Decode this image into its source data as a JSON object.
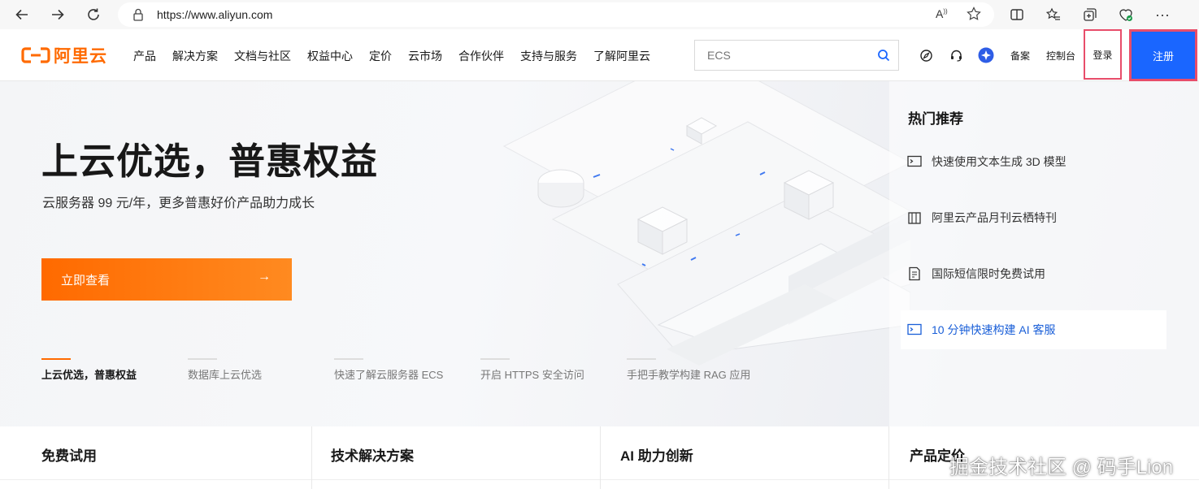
{
  "browser": {
    "url": "https://www.aliyun.com"
  },
  "header": {
    "logo_text": "阿里云",
    "nav": [
      "产品",
      "解决方案",
      "文档与社区",
      "权益中心",
      "定价",
      "云市场",
      "合作伙伴",
      "支持与服务",
      "了解阿里云"
    ],
    "search_placeholder": "ECS",
    "beian": "备案",
    "console": "控制台",
    "login": "登录",
    "register": "注册"
  },
  "hero": {
    "title": "上云优选，普惠权益",
    "subtitle": "云服务器 99 元/年，更多普惠好价产品助力成长",
    "cta": "立即查看",
    "tabs": [
      {
        "label": "上云优选，普惠权益",
        "active": true
      },
      {
        "label": "数据库上云优选",
        "active": false
      },
      {
        "label": "快速了解云服务器 ECS",
        "active": false
      },
      {
        "label": "开启 HTTPS 安全访问",
        "active": false
      },
      {
        "label": "手把手教学构建 RAG 应用",
        "active": false
      }
    ]
  },
  "hot": {
    "title": "热门推荐",
    "items": [
      {
        "label": "快速使用文本生成 3D 模型",
        "icon": "terminal-icon"
      },
      {
        "label": "阿里云产品月刊云栖特刊",
        "icon": "book-icon"
      },
      {
        "label": "国际短信限时免费试用",
        "icon": "document-icon"
      },
      {
        "label": "10 分钟快速构建 AI 客服",
        "icon": "terminal-icon"
      }
    ]
  },
  "cards": [
    "免费试用",
    "技术解决方案",
    "AI 助力创新",
    "产品定价"
  ],
  "watermark": "掘金技术社区 @ 码手Lion",
  "colors": {
    "brand": "#ff6a00",
    "primary": "#1a66ff",
    "highlight": "#e84d6a"
  }
}
